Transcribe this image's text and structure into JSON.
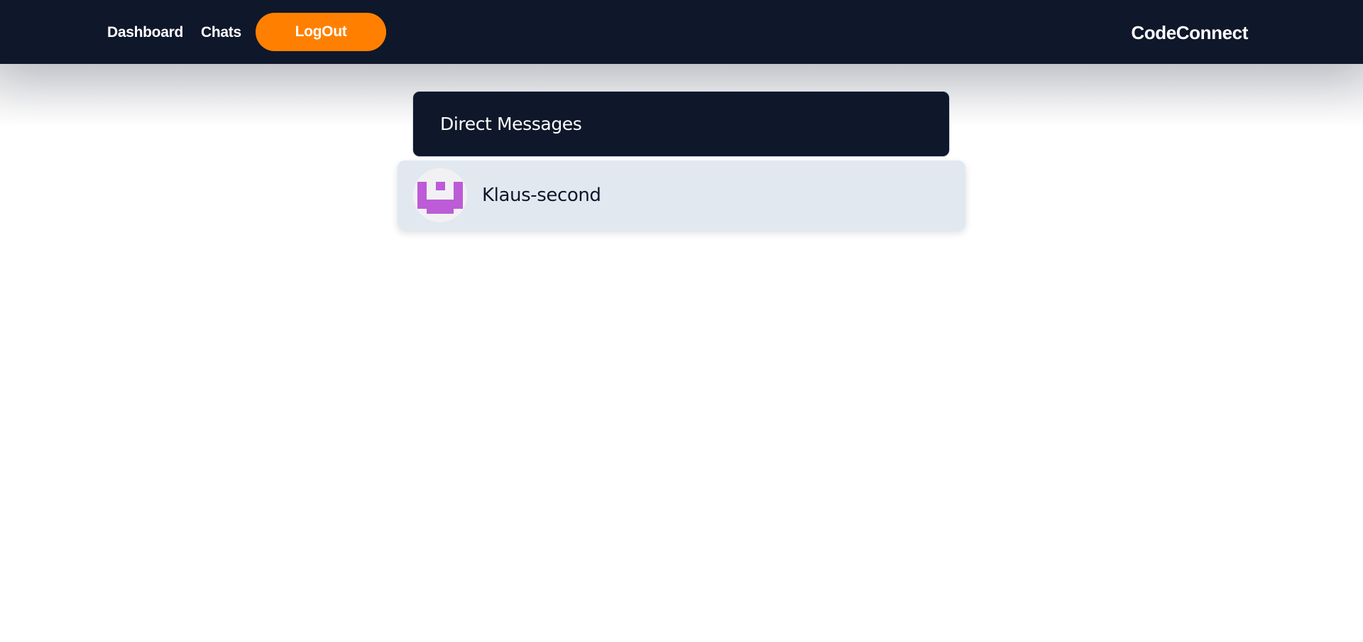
{
  "navbar": {
    "links": [
      {
        "label": "Dashboard"
      },
      {
        "label": "Chats"
      }
    ],
    "logout_label": "LogOut",
    "brand": "CodeConnect",
    "colors": {
      "background": "#0f172a",
      "logout_button": "#ff8000",
      "text": "#ffffff"
    }
  },
  "direct_messages": {
    "title": "Direct Messages",
    "conversations": [
      {
        "name": "Klaus-second",
        "avatar_icon": "identicon-avatar",
        "avatar_color": "#bc5cd6"
      }
    ]
  }
}
